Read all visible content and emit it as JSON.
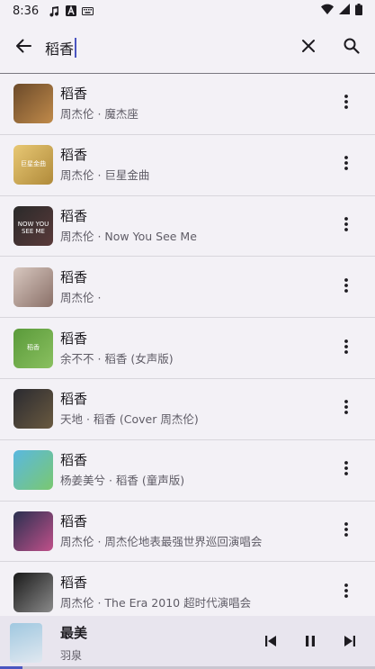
{
  "status_bar": {
    "time": "8:36",
    "icons_left": [
      "music-note-icon",
      "font-a-icon",
      "keyboard-icon"
    ],
    "icons_right": [
      "wifi-icon",
      "signal-icon",
      "battery-icon"
    ]
  },
  "search": {
    "query": "稻香",
    "back_icon": "arrow-left-icon",
    "clear_icon": "close-icon",
    "search_icon": "search-icon"
  },
  "results": [
    {
      "title": "稻香",
      "subtitle": "周杰伦 · 魔杰座",
      "art": [
        "#6b4a2a",
        "#c08a4a"
      ]
    },
    {
      "title": "稻香",
      "subtitle": "周杰伦 · 巨星金曲",
      "art": [
        "#e8c874",
        "#b08a3a"
      ],
      "art_text": "巨星金曲"
    },
    {
      "title": "稻香",
      "subtitle": "周杰伦 · Now You See Me",
      "art": [
        "#2a2a2a",
        "#5a3a3a"
      ],
      "art_text": "NOW YOU SEE ME"
    },
    {
      "title": "稻香",
      "subtitle": "周杰伦 · ",
      "art": [
        "#d8c8c0",
        "#8a7068"
      ]
    },
    {
      "title": "稻香",
      "subtitle": "余不不 · 稻香 (女声版)",
      "art": [
        "#5a9a3a",
        "#8ac060"
      ],
      "art_text": "稻香"
    },
    {
      "title": "稻香",
      "subtitle": "天地 · 稻香 (Cover 周杰伦)",
      "art": [
        "#2a2a30",
        "#6a5a40"
      ]
    },
    {
      "title": "稻香",
      "subtitle": "杨姜美兮 · 稻香 (童声版)",
      "art": [
        "#5ab8e0",
        "#7ac870"
      ]
    },
    {
      "title": "稻香",
      "subtitle": "周杰伦 · 周杰伦地表最强世界巡回演唱会",
      "art": [
        "#2a3050",
        "#c0508a"
      ]
    },
    {
      "title": "稻香",
      "subtitle": "周杰伦 · The Era 2010 超时代演唱会",
      "art": [
        "#1a1a1a",
        "#8a8a8a"
      ]
    }
  ],
  "now_playing": {
    "title": "最美",
    "artist": "羽泉",
    "art": [
      "#a0c8e0",
      "#e0e8f0"
    ],
    "prev_icon": "skip-previous-icon",
    "pause_icon": "pause-icon",
    "next_icon": "skip-next-icon",
    "progress": 0.06
  }
}
